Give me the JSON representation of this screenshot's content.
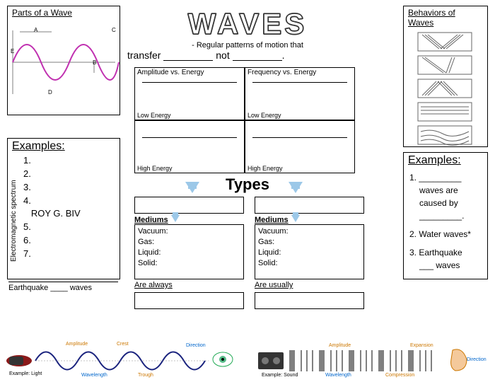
{
  "title": "WAVES",
  "subtitle_prefix": "- Regular patterns of motion that",
  "subtitle_word1": "transfer",
  "subtitle_word2": "not",
  "parts_header": "Parts of a Wave",
  "behaviors_header": "Behaviors of Waves",
  "quad": {
    "tl": "Amplitude vs. Energy",
    "tr": "Frequency vs. Energy",
    "low": "Low Energy",
    "high": "High Energy"
  },
  "types_header": "Types",
  "mediums_header": "Mediums",
  "mediums": [
    "Vacuum:",
    "Gas:",
    "Liquid:",
    "Solid:"
  ],
  "are_always": "Are always",
  "are_usually": "Are usually",
  "examples_hdr": "Examples:",
  "left_examples": [
    "1.",
    "2.",
    "3.",
    "4.",
    "   ROY G. BIV",
    "5.",
    "6.",
    "7."
  ],
  "eq_text": "Earthquake ____ waves",
  "vert_label": "Electromagnetic spectrum",
  "right_examples": {
    "item1a": "1. _________",
    "item1b": "waves are caused by",
    "item1c": "_________.",
    "item2": "2. Water waves*",
    "item3a": "3. Earthquake",
    "item3b": "___ waves"
  },
  "bottom_labels": {
    "amplitude": "Amplitude",
    "crest": "Crest",
    "direction": "Direction",
    "wavelength": "Wavelength",
    "trough": "Trough",
    "ex_light": "Example: Light",
    "ex_sound": "Example: Sound",
    "compression": "Compression",
    "expansion": "Expansion"
  }
}
